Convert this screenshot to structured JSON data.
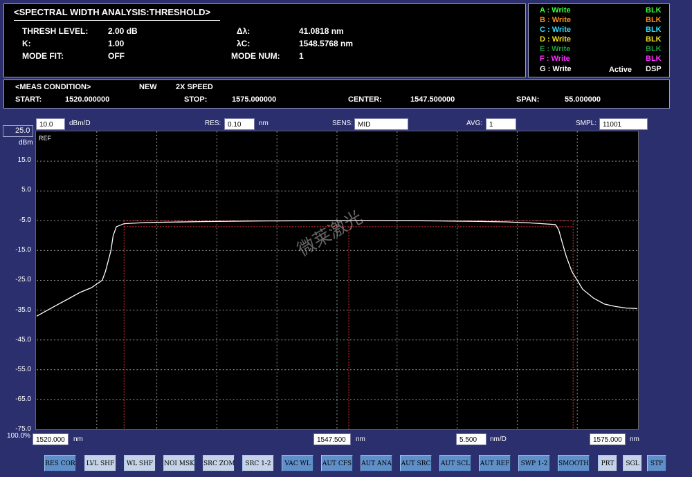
{
  "analysis": {
    "title": "<SPECTRAL WIDTH ANALYSIS:THRESHOLD>",
    "thresh_label": "THRESH LEVEL:",
    "thresh_value": "2.00 dB",
    "k_label": "K:",
    "k_value": "1.00",
    "mode_fit_label": "MODE FIT:",
    "mode_fit_value": "OFF",
    "delta_label": "Δλ:",
    "delta_value": "41.0818 nm",
    "center_label": "λC:",
    "center_value": "1548.5768 nm",
    "mode_num_label": "MODE NUM:",
    "mode_num_value": "1"
  },
  "traces": [
    {
      "label": "A : Write",
      "blk": "BLK",
      "color": "#3cff3c"
    },
    {
      "label": "B : Write",
      "blk": "BLK",
      "color": "#ff8c1a"
    },
    {
      "label": "C : Write",
      "blk": "BLK",
      "color": "#2fe0ff"
    },
    {
      "label": "D : Write",
      "blk": "BLK",
      "color": "#f0e020"
    },
    {
      "label": "E : Write",
      "blk": "BLK",
      "color": "#1f9f3f"
    },
    {
      "label": "F : Write",
      "blk": "BLK",
      "color": "#ff30ff"
    },
    {
      "label": "G : Write",
      "blk": "DSP",
      "color": "#ffffff",
      "status": "Active"
    }
  ],
  "meas": {
    "title": "<MEAS CONDITION>",
    "new_label": "NEW",
    "speed_label": "2X SPEED",
    "start_label": "START:",
    "start_value": "1520.000000",
    "stop_label": "STOP:",
    "stop_value": "1575.000000",
    "center_label": "CENTER:",
    "center_value": "1547.500000",
    "span_label": "SPAN:",
    "span_value": "55.000000"
  },
  "settings": {
    "scale_value": "10.0",
    "scale_unit": "dBm/D",
    "res_label": "RES:",
    "res_value": "0.10",
    "res_unit": "nm",
    "sens_label": "SENS:",
    "sens_value": "MID",
    "avg_label": "AVG:",
    "avg_value": "1",
    "smpl_label": "SMPL:",
    "smpl_value": "11001"
  },
  "plot": {
    "ref_value": "25.0",
    "ref_unit": "dBm",
    "ref_label": "REF",
    "y_ticks": [
      "15.0",
      "5.0",
      "-5.0",
      "-15.0",
      "-25.0",
      "-35.0",
      "-45.0",
      "-55.0",
      "-65.0",
      "-75.0"
    ],
    "bottom_percent": "100.0%",
    "watermark": "微莱激光"
  },
  "chart_data": {
    "type": "line",
    "title": "",
    "xlabel": "nm",
    "ylabel": "dBm",
    "xlim": [
      1520.0,
      1575.0
    ],
    "ylim": [
      -75.0,
      25.0
    ],
    "grid": true,
    "series": [
      {
        "x": [
          1520.0,
          1521.0,
          1522.0,
          1523.0,
          1524.0,
          1525.0,
          1526.0,
          1526.3,
          1526.8,
          1527.0,
          1527.3,
          1528.0,
          1530.0,
          1535.0,
          1540.0,
          1545.0,
          1547.5,
          1550.0,
          1555.0,
          1560.0,
          1563.0,
          1565.0,
          1567.5,
          1567.8,
          1568.1,
          1568.5,
          1569.0,
          1570.0,
          1571.0,
          1572.0,
          1573.0,
          1574.0,
          1575.0
        ],
        "y": [
          -37.0,
          -35.0,
          -33.0,
          -31.0,
          -29.0,
          -27.5,
          -25.0,
          -22.0,
          -15.0,
          -10.0,
          -7.0,
          -6.0,
          -5.6,
          -5.3,
          -5.1,
          -5.0,
          -5.0,
          -4.9,
          -5.0,
          -5.2,
          -5.4,
          -5.7,
          -6.3,
          -8.0,
          -12.0,
          -17.0,
          -22.0,
          -28.0,
          -31.0,
          -33.0,
          -33.8,
          -34.3,
          -34.5
        ],
        "color": "#ffffff"
      }
    ],
    "markers": {
      "threshold_upper_db": -5.0,
      "threshold_lower_db": -7.0,
      "left_nm": 1528.0,
      "center_nm": 1548.58,
      "right_nm": 1569.12,
      "color": "#e83030"
    }
  },
  "axis": {
    "start_value": "1520.000",
    "start_unit": "nm",
    "center_value": "1547.500",
    "center_unit": "nm",
    "div_value": "5.500",
    "div_unit": "nm/D",
    "stop_value": "1575.000",
    "stop_unit": "nm"
  },
  "buttons": [
    {
      "label": "RES COR",
      "style": "blue"
    },
    {
      "label": "LVL SHF",
      "style": "light"
    },
    {
      "label": "WL SHF",
      "style": "light"
    },
    {
      "label": "NOI MSK",
      "style": "light"
    },
    {
      "label": "SRC ZOM",
      "style": "light"
    },
    {
      "label": "SRC 1-2",
      "style": "light"
    },
    {
      "label": "VAC WL",
      "style": "blue"
    },
    {
      "label": "AUT CFS",
      "style": "blue"
    },
    {
      "label": "AUT ANA",
      "style": "blue"
    },
    {
      "label": "AUT SRC",
      "style": "blue"
    },
    {
      "label": "AUT SCL",
      "style": "blue"
    },
    {
      "label": "AUT REF",
      "style": "blue"
    },
    {
      "label": "SWP 1-2",
      "style": "blue"
    },
    {
      "label": "SMOOTH",
      "style": "blue"
    },
    {
      "label": "PRT",
      "style": "light"
    },
    {
      "label": "SGL",
      "style": "light"
    },
    {
      "label": "STP",
      "style": "blue"
    }
  ]
}
